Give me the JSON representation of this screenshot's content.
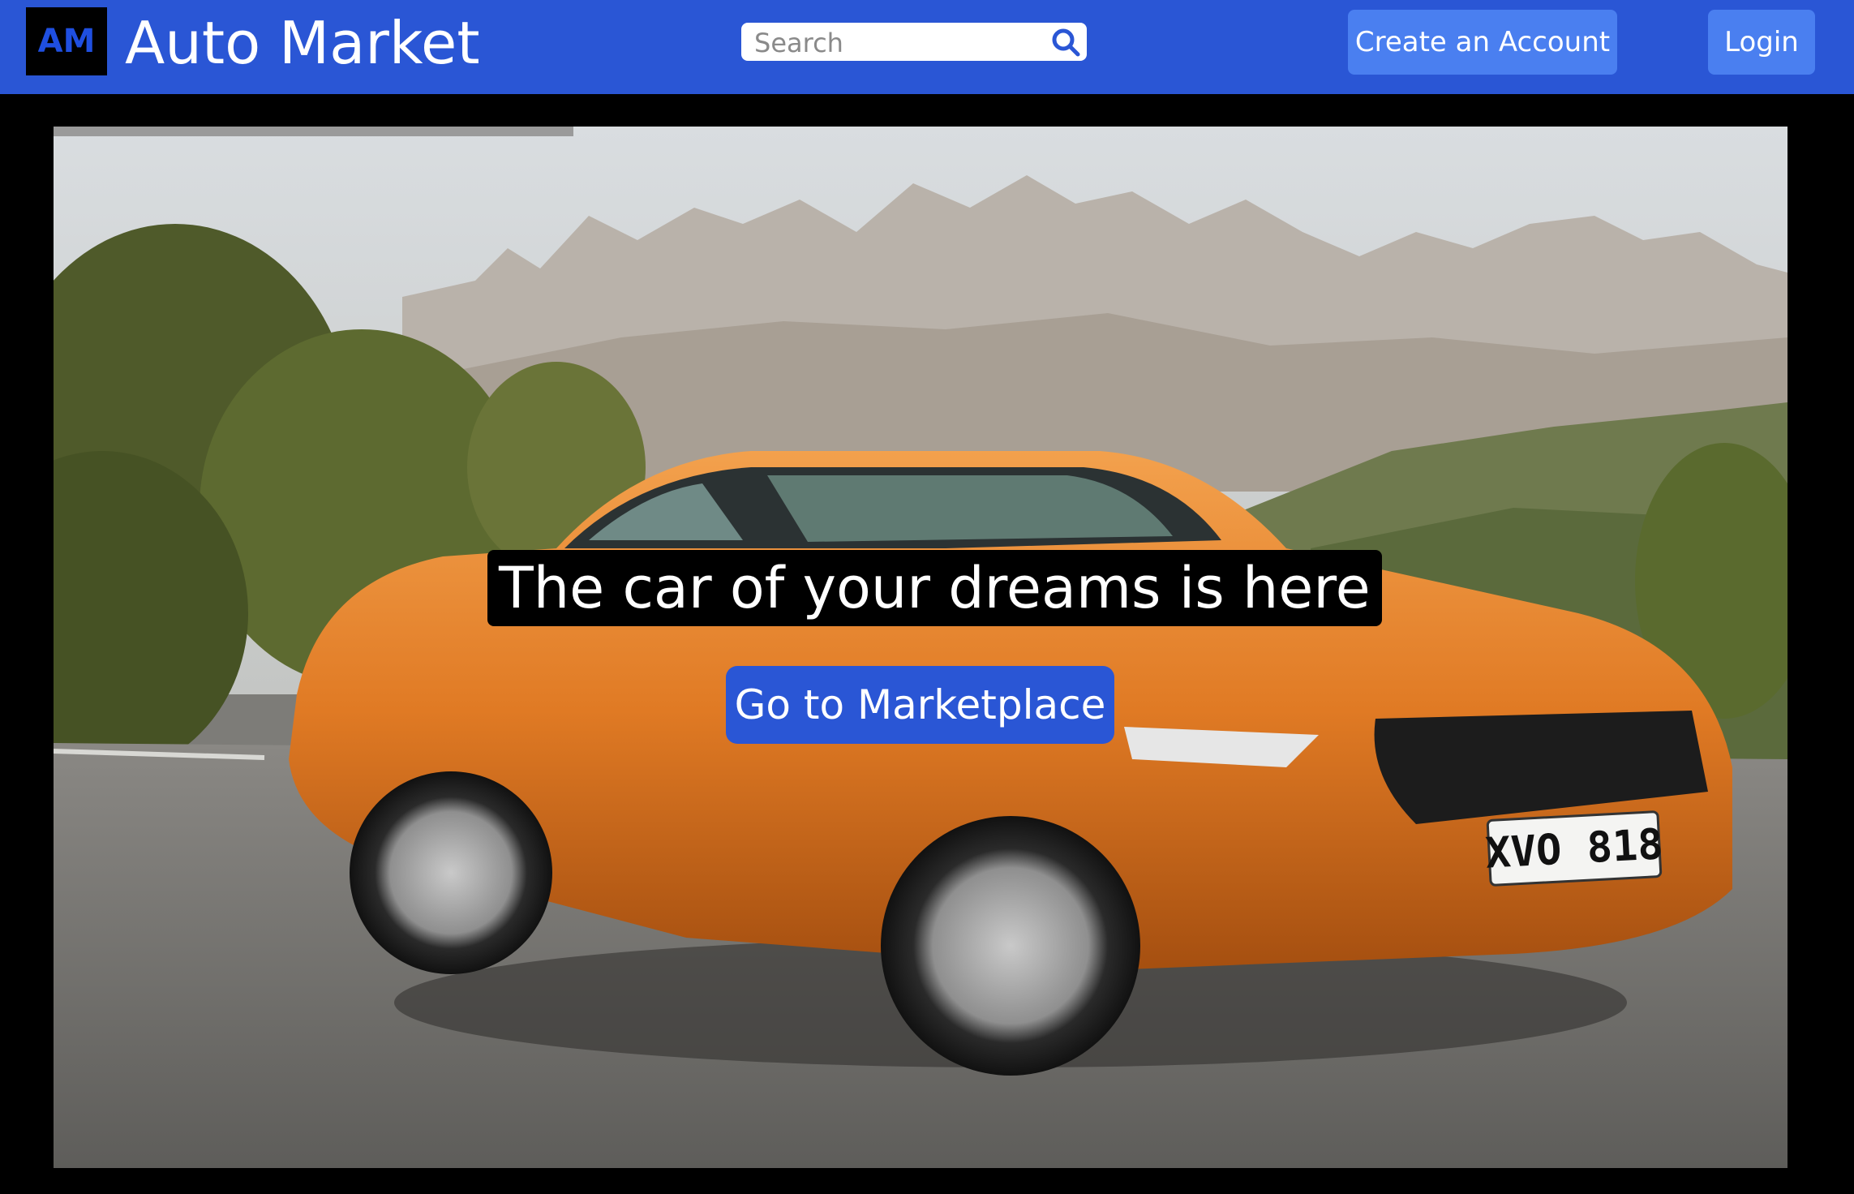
{
  "navbar": {
    "logo_text": "AM",
    "brand": "Auto Market",
    "search": {
      "placeholder": "Search",
      "value": "",
      "icon": "search-icon"
    },
    "create_account_label": "Create an Account",
    "login_label": "Login",
    "background_color": "#2a56d5",
    "button_color": "#4a7ff0"
  },
  "hero": {
    "image_subject": "orange sports car on a mountain road",
    "carousel_progress": 0.3,
    "headline": "The car of your dreams is here",
    "plate_text": "XVO 818",
    "cta_label": "Go to Marketplace",
    "cta_color": "#2a56d5"
  }
}
